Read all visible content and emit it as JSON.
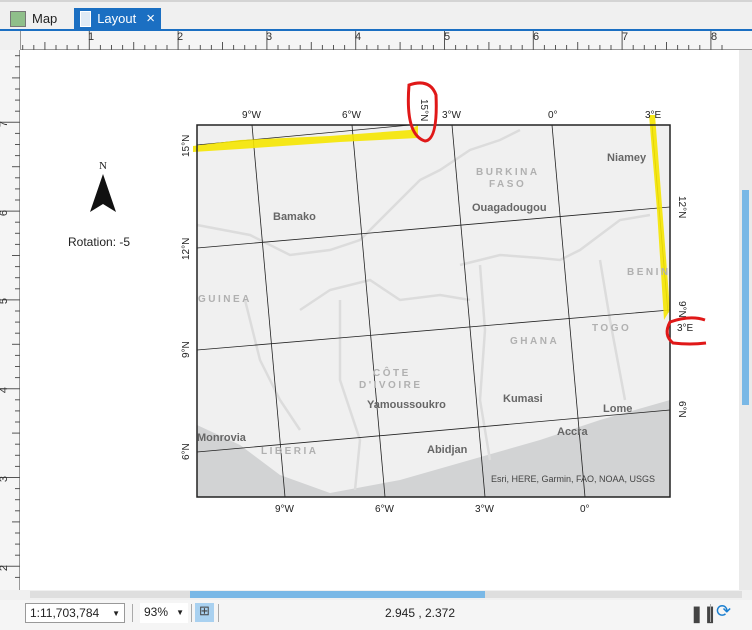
{
  "tabs": [
    {
      "label": "Map",
      "active": false
    },
    {
      "label": "Layout",
      "active": true,
      "close": "×"
    }
  ],
  "ruler": {
    "top": [
      "1",
      "2",
      "3",
      "4",
      "5",
      "6",
      "7",
      "8"
    ],
    "left": [
      "7",
      "6",
      "5",
      "4",
      "3",
      "2"
    ]
  },
  "north_arrow": {
    "label": "N",
    "rotation_text": "Rotation:  -5"
  },
  "map": {
    "top_labels": [
      "9°W",
      "6°W",
      "3°W",
      "0°",
      "3°E"
    ],
    "bottom_labels": [
      "9°W",
      "6°W",
      "3°W",
      "0°"
    ],
    "left_labels": [
      "15°N",
      "12°N",
      "9°N",
      "6°N"
    ],
    "right_labels": [
      "12°N",
      "9°N",
      "6°N"
    ],
    "circled_top": "15°N",
    "circled_right": "3°E",
    "countries": [
      "BURKINA",
      "FASO",
      "GUINEA",
      "BENIN",
      "TOGO",
      "GHANA",
      "CÔTE",
      "D'IVOIRE",
      "LIBERIA"
    ],
    "cities": [
      "Niamey",
      "Bamako",
      "Ouagadougou",
      "Yamoussoukro",
      "Kumasi",
      "Lome",
      "Accra",
      "Monrovia",
      "Abidjan"
    ],
    "attribution": "Esri, HERE, Garmin, FAO, NOAA, USGS",
    "colors": {
      "land": "#f0f0f0",
      "water": "#d2d3d4",
      "highlight": "#f5e600",
      "circle": "#e01818"
    }
  },
  "status": {
    "scale": "1:11,703,784",
    "zoom": "93%",
    "coords": "2.945 , 2.372"
  }
}
